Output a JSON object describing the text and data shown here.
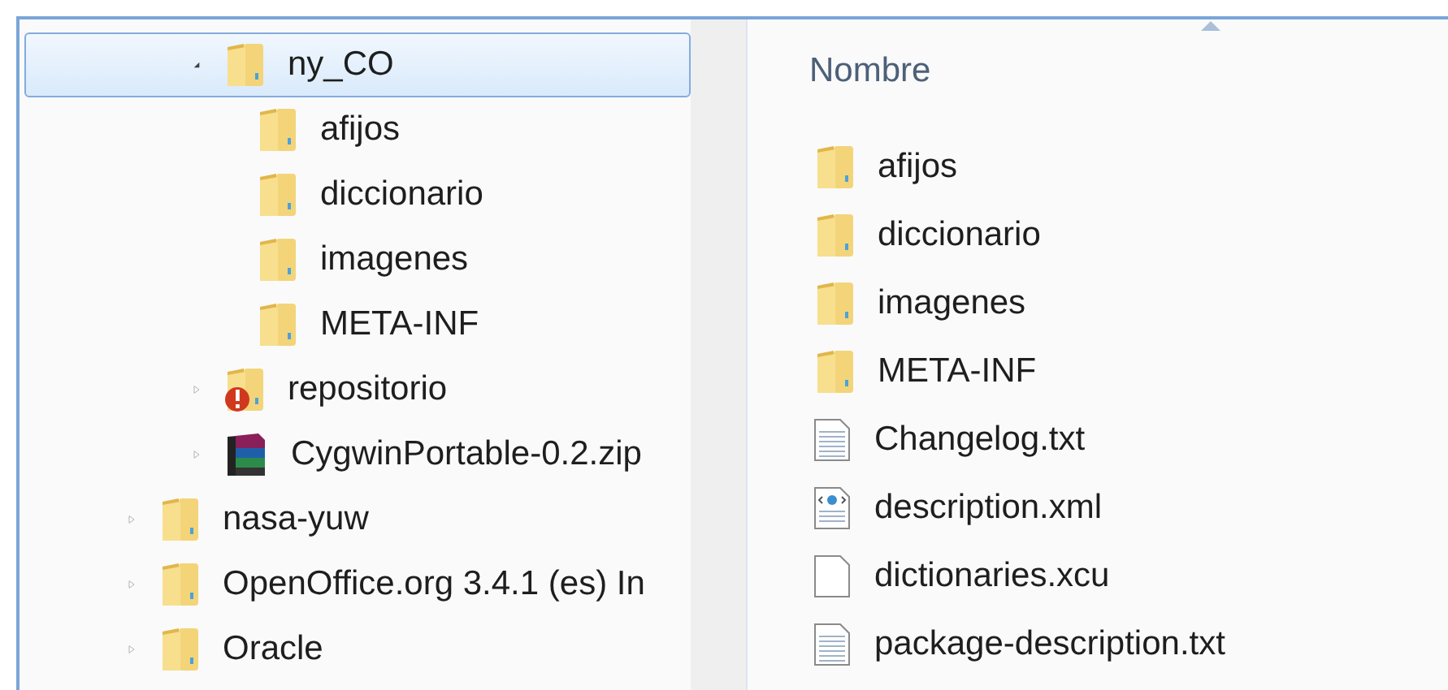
{
  "tree": {
    "items": [
      {
        "children": [
          {
            "children": [
              {
                "label": "ny_CO",
                "kind": "folder",
                "expanded": true,
                "selected": true,
                "children": [
                  {
                    "label": "afijos",
                    "kind": "folder",
                    "selected": false
                  },
                  {
                    "label": "diccionario",
                    "kind": "folder",
                    "selected": false
                  },
                  {
                    "label": "imagenes",
                    "kind": "folder",
                    "selected": false
                  },
                  {
                    "label": "META-INF",
                    "kind": "folder",
                    "selected": false
                  }
                ]
              },
              {
                "label": "repositorio",
                "kind": "folder-error",
                "expanded": false,
                "selected": false
              },
              {
                "label": "CygwinPortable-0.2.zip",
                "kind": "archive",
                "expanded": false,
                "selected": false
              }
            ]
          }
        ]
      },
      {
        "label": "nasa-yuw",
        "kind": "folder",
        "expanded": false,
        "selected": false
      },
      {
        "label": "OpenOffice.org 3.4.1 (es) In",
        "kind": "folder",
        "expanded": false,
        "selected": false
      },
      {
        "label": "Oracle",
        "kind": "folder",
        "expanded": false,
        "selected": false
      }
    ]
  },
  "file_list": {
    "column": "Nombre",
    "items": [
      {
        "name": "afijos",
        "kind": "folder"
      },
      {
        "name": "diccionario",
        "kind": "folder"
      },
      {
        "name": "imagenes",
        "kind": "folder"
      },
      {
        "name": "META-INF",
        "kind": "folder"
      },
      {
        "name": "Changelog.txt",
        "kind": "text"
      },
      {
        "name": "description.xml",
        "kind": "xml"
      },
      {
        "name": "dictionaries.xcu",
        "kind": "blank"
      },
      {
        "name": "package-description.txt",
        "kind": "text"
      }
    ]
  }
}
